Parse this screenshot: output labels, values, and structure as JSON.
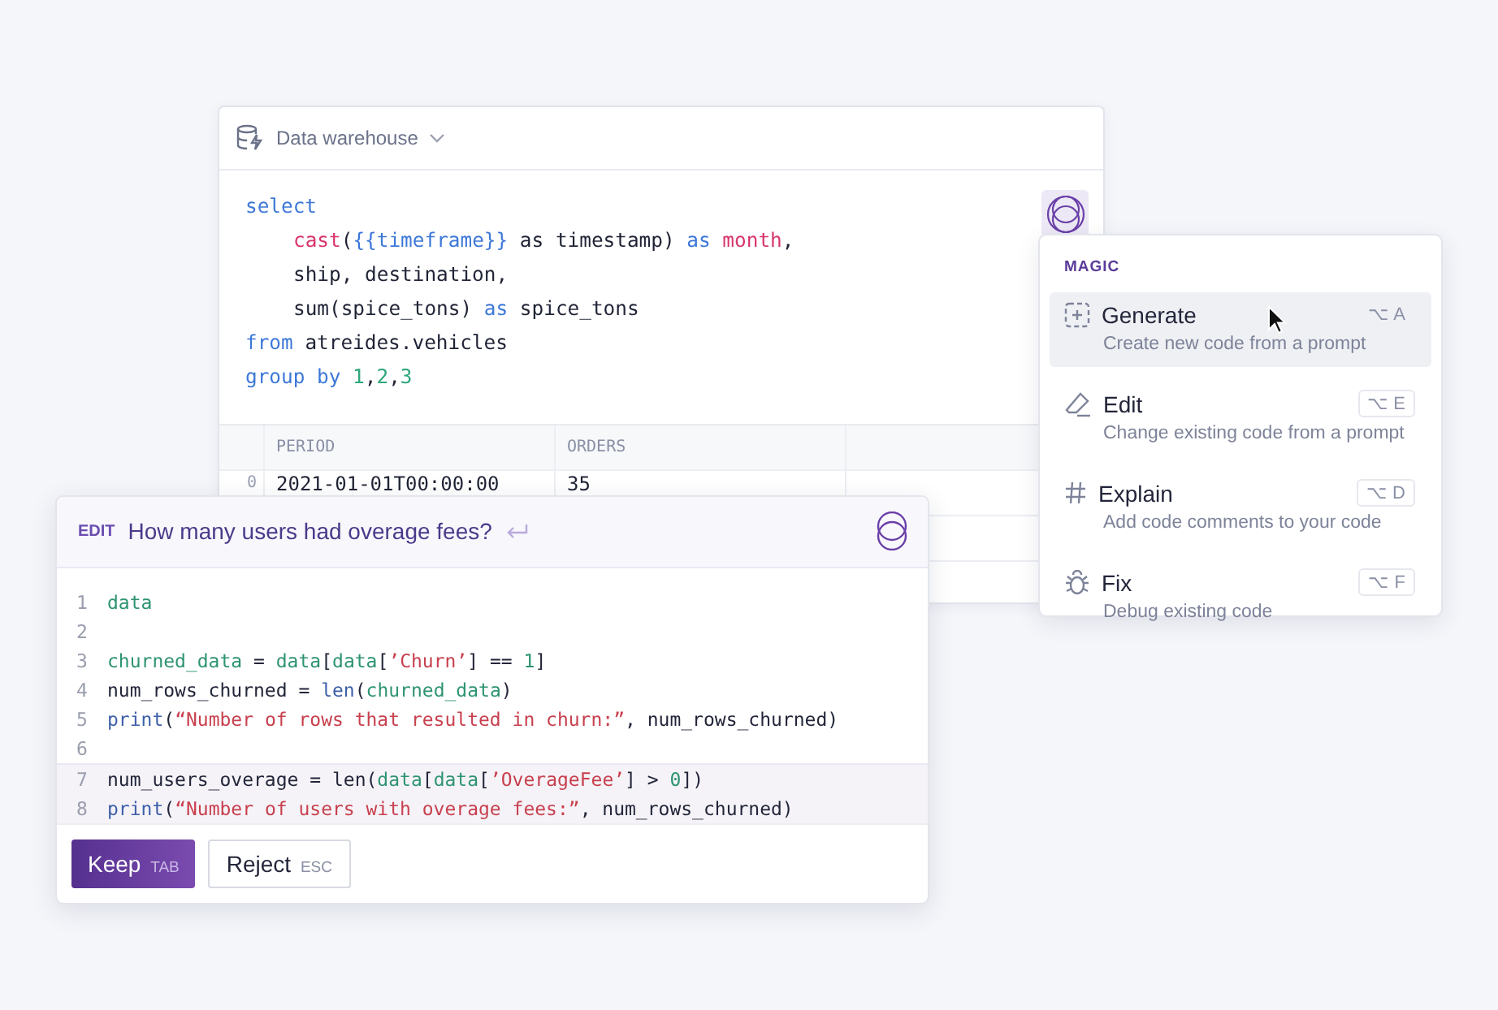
{
  "sql_cell": {
    "source": "Data warehouse",
    "code": [
      {
        "indent": false,
        "tokens": [
          {
            "t": "select",
            "kind": "keyword"
          }
        ]
      },
      {
        "indent": true,
        "tokens": [
          {
            "t": "cast",
            "kind": "function"
          },
          {
            "t": "(",
            "kind": "plain"
          },
          {
            "t": "{{timeframe}}",
            "kind": "template"
          },
          {
            "t": " as timestamp) ",
            "kind": "plain"
          },
          {
            "t": "as",
            "kind": "keyword"
          },
          {
            "t": " month",
            "kind": "function"
          },
          {
            "t": ",",
            "kind": "plain"
          }
        ]
      },
      {
        "indent": true,
        "tokens": [
          {
            "t": "ship, destination,",
            "kind": "plain"
          }
        ]
      },
      {
        "indent": true,
        "tokens": [
          {
            "t": "sum(spice_tons) ",
            "kind": "plain"
          },
          {
            "t": "as",
            "kind": "keyword"
          },
          {
            "t": " spice_tons",
            "kind": "plain"
          }
        ]
      },
      {
        "indent": false,
        "tokens": [
          {
            "t": "from",
            "kind": "keyword"
          },
          {
            "t": " atreides.vehicles",
            "kind": "plain"
          }
        ]
      },
      {
        "indent": false,
        "tokens": [
          {
            "t": "group by",
            "kind": "keyword"
          },
          {
            "t": " 1",
            "kind": "number"
          },
          {
            "t": ",",
            "kind": "plain"
          },
          {
            "t": "2",
            "kind": "number"
          },
          {
            "t": ",",
            "kind": "plain"
          },
          {
            "t": "3",
            "kind": "number"
          }
        ]
      }
    ],
    "table": {
      "columns": [
        "PERIOD",
        "ORDERS"
      ],
      "rows": [
        {
          "index": "0",
          "cells": [
            "2021-01-01T00:00:00",
            "35"
          ]
        }
      ]
    }
  },
  "magic_menu": {
    "title": "MAGIC",
    "items": [
      {
        "kind": "generate",
        "label": "Generate",
        "description": "Create new code from a prompt",
        "shortcut": "⌥ A",
        "selected": true
      },
      {
        "kind": "edit",
        "label": "Edit",
        "description": "Change existing code from a prompt",
        "shortcut": "⌥ E",
        "selected": false
      },
      {
        "kind": "explain",
        "label": "Explain",
        "description": "Add code comments to your code",
        "shortcut": "⌥ D",
        "selected": false
      },
      {
        "kind": "fix",
        "label": "Fix",
        "description": "Debug existing code",
        "shortcut": "⌥ F",
        "selected": false
      }
    ]
  },
  "edit_panel": {
    "mode": "EDIT",
    "prompt": "How many users had overage fees?",
    "lines": [
      {
        "number": "1",
        "highlighted": false,
        "tokens": [
          {
            "t": "data",
            "kind": "name"
          }
        ]
      },
      {
        "number": "2",
        "highlighted": false
      },
      {
        "number": "3",
        "highlighted": false,
        "tokens": [
          {
            "t": "churned_data",
            "kind": "name"
          },
          {
            "t": " = ",
            "kind": "plain"
          },
          {
            "t": "data",
            "kind": "name"
          },
          {
            "t": "[",
            "kind": "plain"
          },
          {
            "t": "data",
            "kind": "name"
          },
          {
            "t": "[",
            "kind": "plain"
          },
          {
            "t": "’Churn’",
            "kind": "string"
          },
          {
            "t": "] == ",
            "kind": "plain"
          },
          {
            "t": "1",
            "kind": "name"
          },
          {
            "t": "]",
            "kind": "plain"
          }
        ]
      },
      {
        "number": "4",
        "highlighted": false,
        "tokens": [
          {
            "t": "num_rows_churned = ",
            "kind": "plain"
          },
          {
            "t": "len",
            "kind": "builtin"
          },
          {
            "t": "(",
            "kind": "plain"
          },
          {
            "t": "churned_data",
            "kind": "name"
          },
          {
            "t": ")",
            "kind": "plain"
          }
        ]
      },
      {
        "number": "5",
        "highlighted": false,
        "tokens": [
          {
            "t": "print",
            "kind": "builtin"
          },
          {
            "t": "(",
            "kind": "plain"
          },
          {
            "t": "“Number of rows that resulted in churn:”",
            "kind": "string"
          },
          {
            "t": ", num_rows_churned)",
            "kind": "plain"
          }
        ]
      },
      {
        "number": "6",
        "highlighted": false
      },
      {
        "number": "7",
        "highlighted": true,
        "tokens": [
          {
            "t": "num_users_overage = len(",
            "kind": "plain"
          },
          {
            "t": "data",
            "kind": "name"
          },
          {
            "t": "[",
            "kind": "plain"
          },
          {
            "t": "data",
            "kind": "name"
          },
          {
            "t": "[",
            "kind": "plain"
          },
          {
            "t": "’OverageFee’",
            "kind": "string"
          },
          {
            "t": "] > ",
            "kind": "plain"
          },
          {
            "t": "0",
            "kind": "name"
          },
          {
            "t": "])",
            "kind": "plain"
          }
        ]
      },
      {
        "number": "8",
        "highlighted": true,
        "tokens": [
          {
            "t": "print",
            "kind": "builtin"
          },
          {
            "t": "(",
            "kind": "plain"
          },
          {
            "t": "“Number of users with overage fees:”",
            "kind": "string"
          },
          {
            "t": ", num_rows_churned)",
            "kind": "plain"
          }
        ]
      }
    ],
    "buttons": [
      {
        "kind": "primary",
        "label": "Keep",
        "key": "TAB"
      },
      {
        "kind": "secondary",
        "label": "Reject",
        "key": "ESC"
      }
    ]
  }
}
